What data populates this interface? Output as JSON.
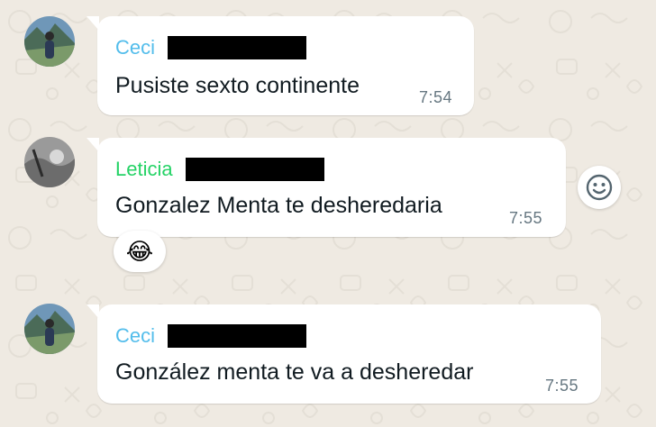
{
  "messages": [
    {
      "sender": "Ceci",
      "sender_color": "#53bdeb",
      "text": "Pusiste sexto continente",
      "time": "7:54"
    },
    {
      "sender": "Leticia",
      "sender_color": "#25d366",
      "text": "Gonzalez Menta te desheredaria",
      "time": "7:55",
      "reaction": "😂"
    },
    {
      "sender": "Ceci",
      "sender_color": "#53bdeb",
      "text": "González menta te va a desheredar",
      "time": "7:55"
    }
  ],
  "icons": {
    "reaction_button": "smiley-face-icon"
  },
  "colors": {
    "background": "#efeae2",
    "bubble": "#ffffff",
    "time": "#667781",
    "ceci_name": "#53bdeb",
    "leticia_name": "#25d366"
  }
}
